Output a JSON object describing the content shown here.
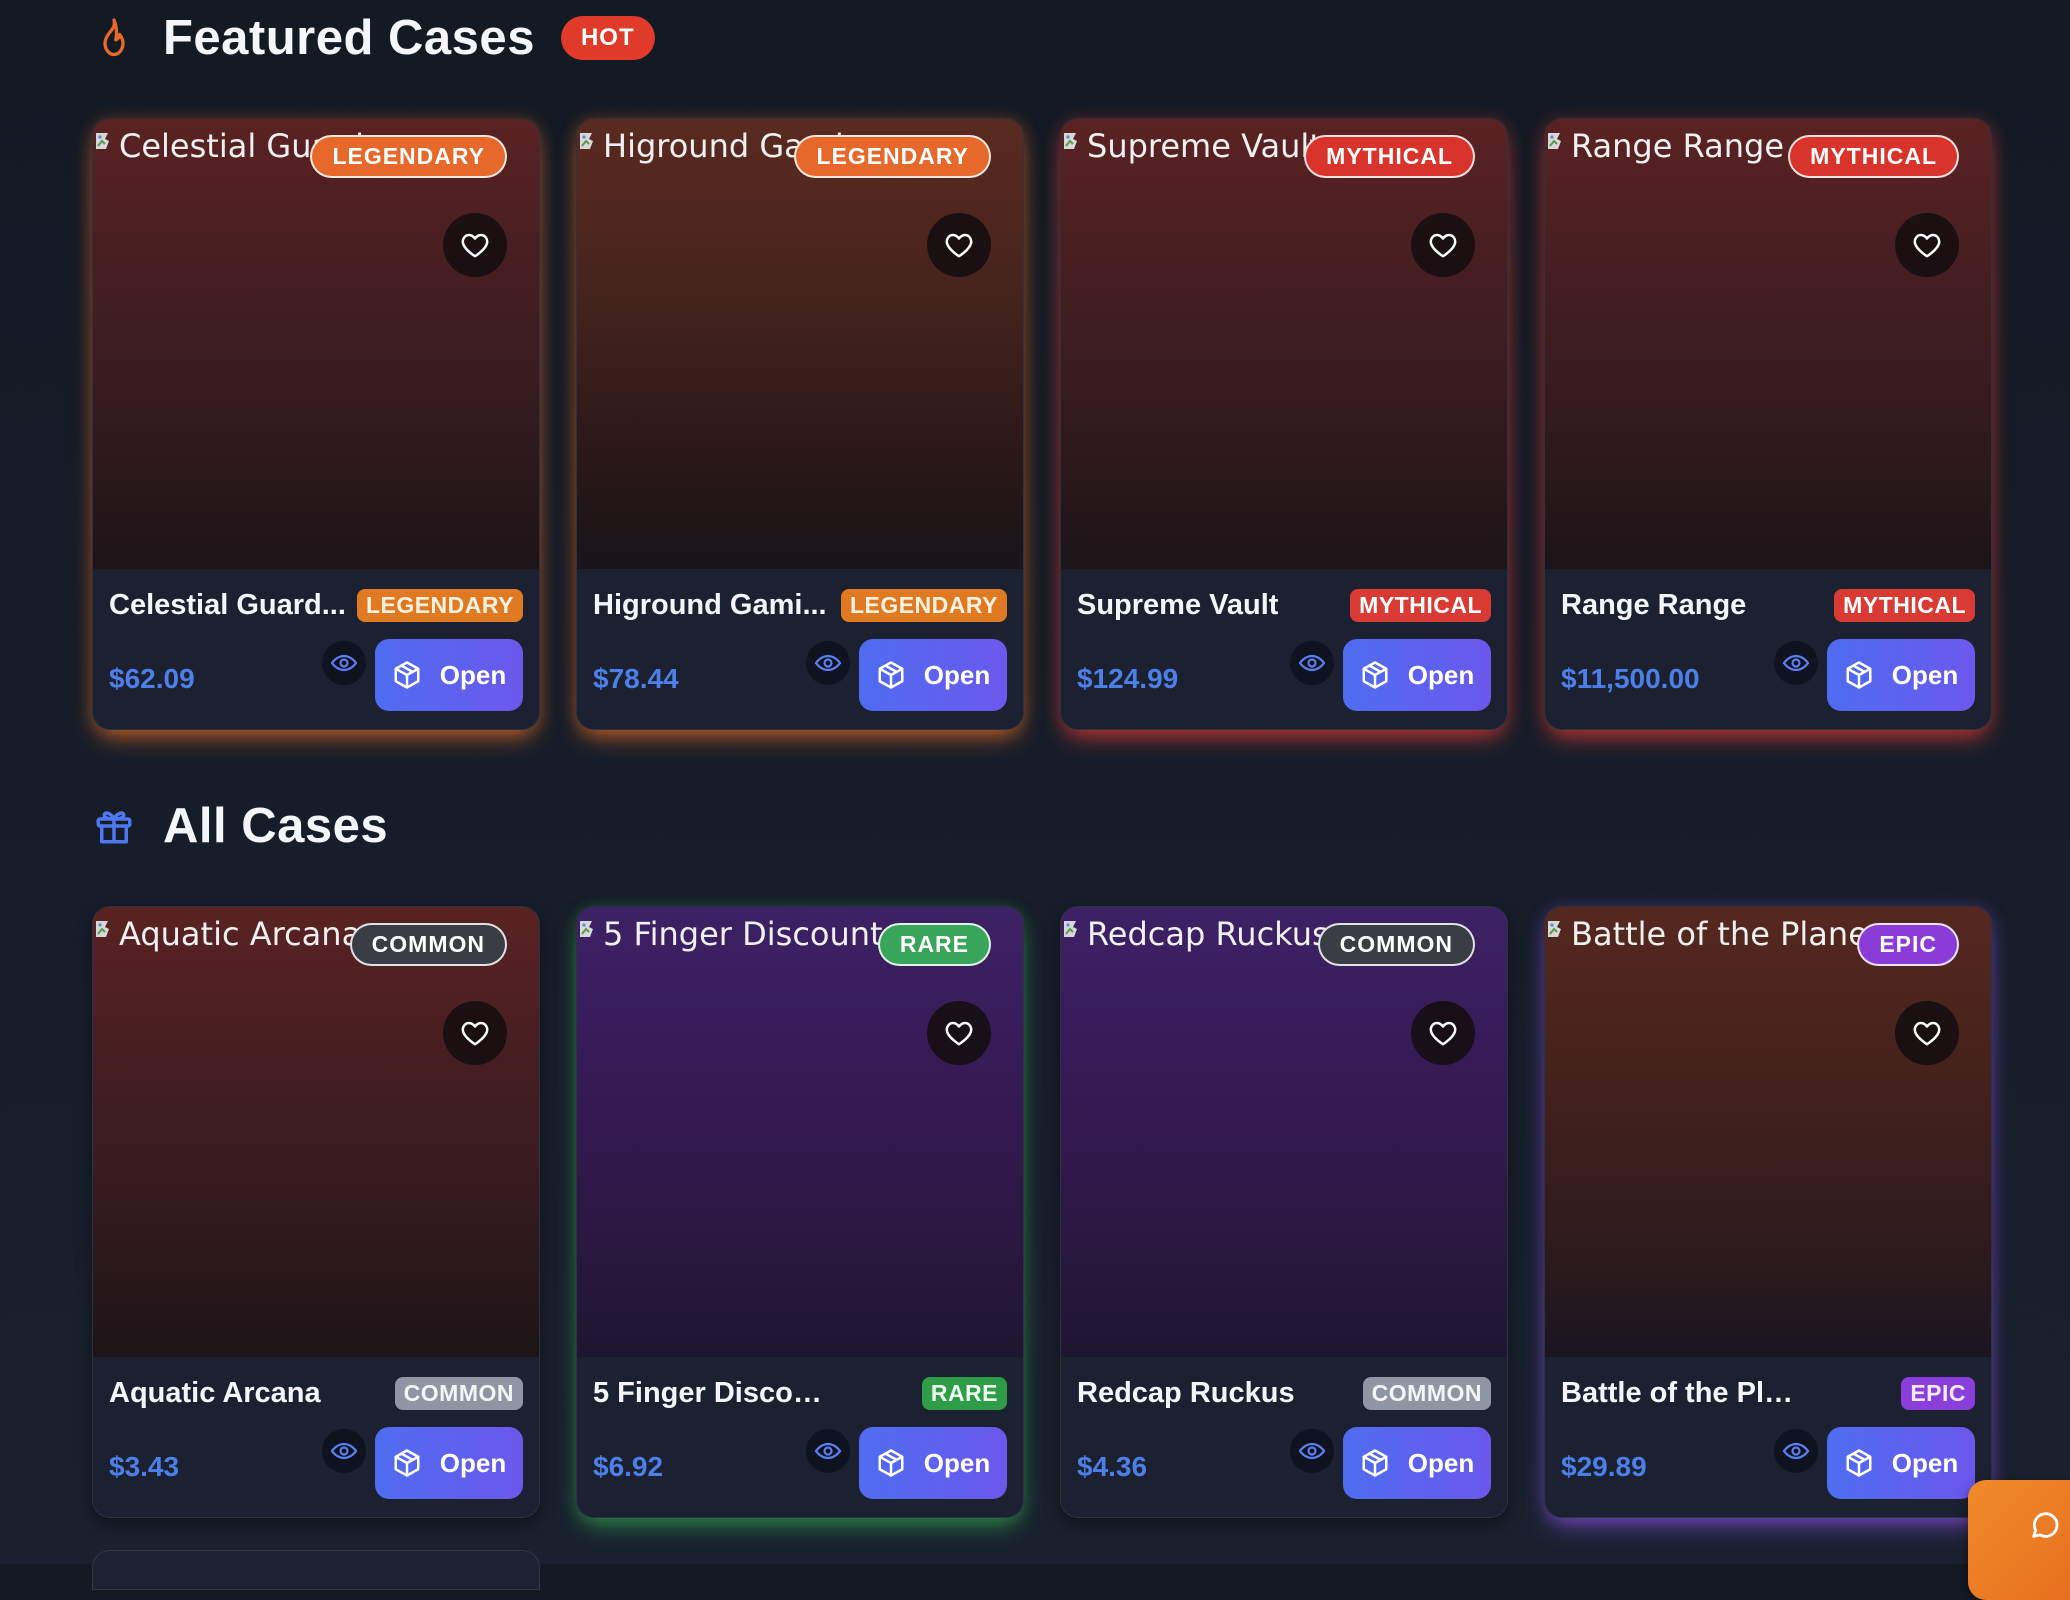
{
  "featured": {
    "title": "Featured Cases",
    "hot_label": "HOT",
    "cards": [
      {
        "alt": "Celestial Guard...",
        "name": "Celestial Guard...",
        "rarity": "LEGENDARY",
        "price": "$62.09",
        "open_label": "Open"
      },
      {
        "alt": "Higround Gami...",
        "name": "Higround Gami...",
        "rarity": "LEGENDARY",
        "price": "$78.44",
        "open_label": "Open"
      },
      {
        "alt": "Supreme Vault",
        "name": "Supreme Vault",
        "rarity": "MYTHICAL",
        "price": "$124.99",
        "open_label": "Open"
      },
      {
        "alt": "Range Range",
        "name": "Range Range",
        "rarity": "MYTHICAL",
        "price": "$11,500.00",
        "open_label": "Open"
      }
    ]
  },
  "all": {
    "title": "All Cases",
    "cards": [
      {
        "alt": "Aquatic Arcana",
        "name": "Aquatic Arcana",
        "rarity": "COMMON",
        "price": "$3.43",
        "open_label": "Open"
      },
      {
        "alt": "5 Finger Discount",
        "name": "5 Finger Discount",
        "rarity": "RARE",
        "price": "$6.92",
        "open_label": "Open"
      },
      {
        "alt": "Redcap Ruckus",
        "name": "Redcap Ruckus",
        "rarity": "COMMON",
        "price": "$4.36",
        "open_label": "Open"
      },
      {
        "alt": "Battle of the Planes",
        "name": "Battle of the Planes",
        "rarity": "EPIC",
        "price": "$29.89",
        "open_label": "Open"
      }
    ]
  },
  "icons": {
    "featured_section": "flame-icon",
    "all_section": "gift-icon",
    "favorite": "heart-icon",
    "preview": "eye-icon",
    "open": "box-icon",
    "chat": "chat-icon"
  },
  "colors": {
    "background": "#161d29",
    "card": "#1b2130",
    "price": "#4d7fe8",
    "open_button": "#5a63ee",
    "hot": "#e03b2a",
    "legendary": "#e07a22",
    "mythical": "#d93a33",
    "common": "#8f96a3",
    "rare": "#2f9d47",
    "epic": "#8a3fdb",
    "chat_button": "#f08a2a"
  }
}
